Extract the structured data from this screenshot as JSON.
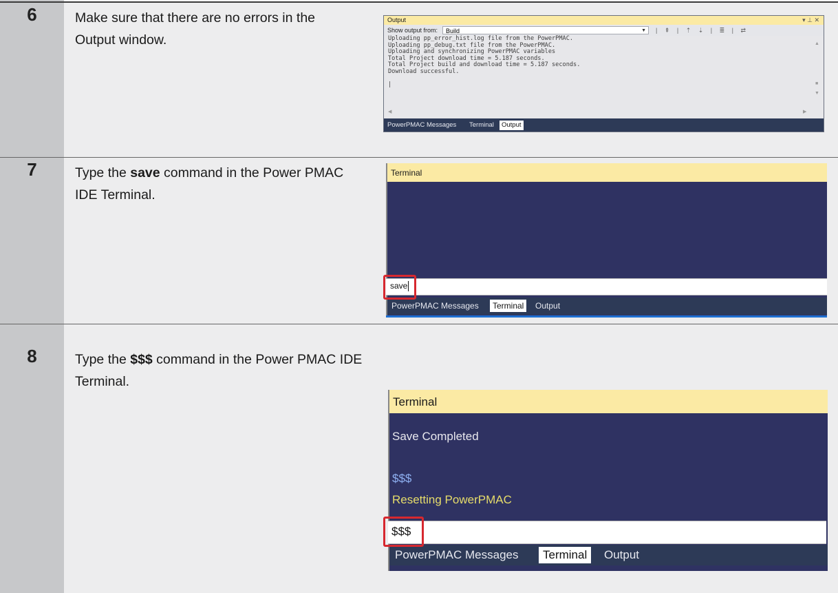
{
  "steps": [
    {
      "number": "6",
      "text": "Make sure that there are no errors in the Output window."
    },
    {
      "number": "7",
      "text_before": "Type the ",
      "text_bold": "save",
      "text_after": " command in the Power PMAC IDE Terminal."
    },
    {
      "number": "8",
      "text_before": "Type the ",
      "text_bold": "$$$",
      "text_after": " command in the Power PMAC IDE Terminal."
    }
  ],
  "output_window": {
    "title": "Output",
    "window_icons": "▾ ⊥ ✕",
    "show_output_label": "Show output from:",
    "show_output_value": "Build",
    "log_lines": [
      "Uploading pp_error_hist.log file from the PowerPMAC.",
      "Uploading pp_debug.txt file from the PowerPMAC.",
      "Uploading and synchronizing PowerPMAC variables",
      "Total Project download time = 5.187 seconds.",
      "Total Project build and download time = 5.187 seconds.",
      "Download successful.",
      "",
      "|"
    ],
    "tabs": [
      "PowerPMAC Messages",
      "Terminal",
      "Output"
    ],
    "active_tab": "Output"
  },
  "terminal_step7": {
    "title": "Terminal",
    "input_value": "save",
    "tabs": [
      "PowerPMAC Messages",
      "Terminal",
      "Output"
    ],
    "active_tab": "Terminal"
  },
  "terminal_step8": {
    "title": "Terminal",
    "lines": [
      "Save Completed",
      "$$$",
      "Resetting PowerPMAC"
    ],
    "input_value": "$$$",
    "tabs": [
      "PowerPMAC Messages",
      "Terminal",
      "Output"
    ],
    "active_tab": "Terminal"
  },
  "colors": {
    "terminal_bg": "#2f3262",
    "title_bg": "#fbeaa4",
    "highlight_red": "#d7282f",
    "echo_command": "#8fb1f2",
    "reset_message": "#e6dc6a",
    "normal_text": "#e8e8ee"
  }
}
